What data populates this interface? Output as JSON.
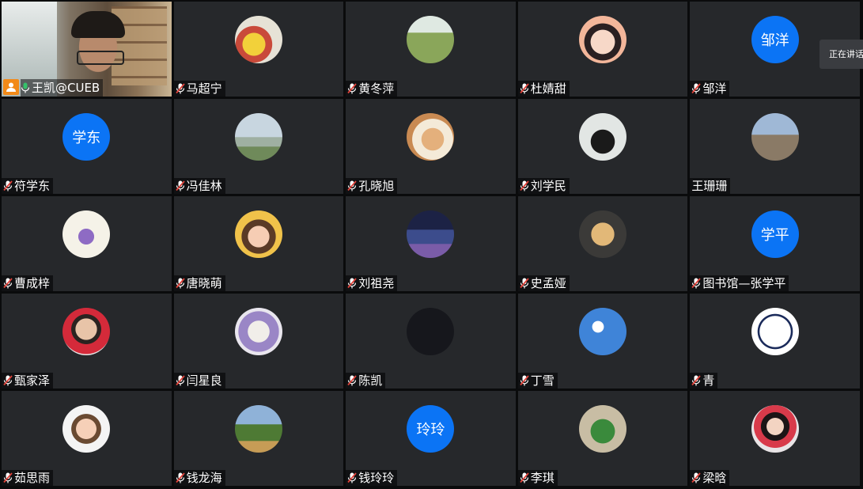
{
  "self": {
    "name": "王凯@CUEB"
  },
  "tooltip": "正在讲话",
  "participants": [
    {
      "name": "马超宁",
      "avatar": "photo",
      "avatar_icon": "pikachu-photo"
    },
    {
      "name": "黄冬萍",
      "avatar": "photo",
      "avatar_icon": "field-person-photo"
    },
    {
      "name": "杜婧甜",
      "avatar": "photo",
      "avatar_icon": "cartoon-girl-photo"
    },
    {
      "name": "邹洋",
      "avatar": "text",
      "avatar_text": "邹洋"
    },
    {
      "name": "符学东",
      "avatar": "text",
      "avatar_text": "学东"
    },
    {
      "name": "冯佳林",
      "avatar": "photo",
      "avatar_icon": "seaside-person-photo"
    },
    {
      "name": "孔晓旭",
      "avatar": "photo",
      "avatar_icon": "cats-photo"
    },
    {
      "name": "刘学民",
      "avatar": "photo",
      "avatar_icon": "ox-photo"
    },
    {
      "name": "王珊珊",
      "avatar": "photo",
      "avatar_icon": "church-photo",
      "mic_hidden": true
    },
    {
      "name": "曹成梓",
      "avatar": "photo",
      "avatar_icon": "cartoon-creature-photo"
    },
    {
      "name": "唐晓萌",
      "avatar": "photo",
      "avatar_icon": "child-photo"
    },
    {
      "name": "刘祖尧",
      "avatar": "photo",
      "avatar_icon": "night-city-photo"
    },
    {
      "name": "史孟娅",
      "avatar": "photo",
      "avatar_icon": "dog-photo"
    },
    {
      "name": "图书馆—张学平",
      "avatar": "text",
      "avatar_text": "学平"
    },
    {
      "name": "甄家泽",
      "avatar": "photo",
      "avatar_icon": "smiling-man-photo"
    },
    {
      "name": "闫星良",
      "avatar": "photo",
      "avatar_icon": "anime-boy-photo"
    },
    {
      "name": "陈凯",
      "avatar": "photo",
      "avatar_icon": "dark-photo"
    },
    {
      "name": "丁雪",
      "avatar": "photo",
      "avatar_icon": "sky-photo"
    },
    {
      "name": "青",
      "avatar": "photo",
      "avatar_icon": "sketch-girl-photo"
    },
    {
      "name": "茹思雨",
      "avatar": "photo",
      "avatar_icon": "cartoon-boy-photo"
    },
    {
      "name": "钱龙海",
      "avatar": "photo",
      "avatar_icon": "landscape-photo"
    },
    {
      "name": "钱玲玲",
      "avatar": "text",
      "avatar_text": "玲玲"
    },
    {
      "name": "李琪",
      "avatar": "photo",
      "avatar_icon": "dinosaur-photo"
    },
    {
      "name": "梁晗",
      "avatar": "photo",
      "avatar_icon": "woman-photo"
    }
  ],
  "colors": {
    "tile_bg": "#26282b",
    "background": "#0a0b0c",
    "text_avatar_bg": "#0b74f5",
    "active_speaker_border": "#3cc06a",
    "mic_off": "#e0423a",
    "self_icon_bg": "#f28a19"
  }
}
